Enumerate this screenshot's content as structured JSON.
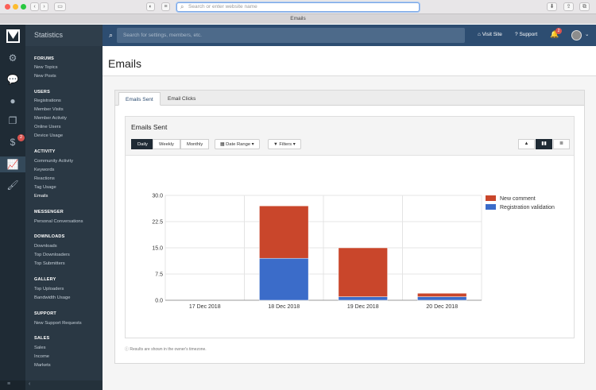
{
  "browser": {
    "url_placeholder": "Search or enter website name",
    "tab_title": "Emails"
  },
  "sidebar": {
    "title": "Statistics",
    "badge_count": "2",
    "sections": [
      {
        "title": "FORUMS",
        "links": [
          "New Topics",
          "New Posts"
        ]
      },
      {
        "title": "USERS",
        "links": [
          "Registrations",
          "Member Visits",
          "Member Activity",
          "Online Users",
          "Device Usage"
        ]
      },
      {
        "title": "ACTIVITY",
        "links": [
          "Community Activity",
          "Keywords",
          "Reactions",
          "Tag Usage",
          "Emails"
        ]
      },
      {
        "title": "MESSENGER",
        "links": [
          "Personal Conversations"
        ]
      },
      {
        "title": "DOWNLOADS",
        "links": [
          "Downloads",
          "Top Downloaders",
          "Top Submitters"
        ]
      },
      {
        "title": "GALLERY",
        "links": [
          "Top Uploaders",
          "Bandwidth Usage"
        ]
      },
      {
        "title": "SUPPORT",
        "links": [
          "New Support Requests"
        ]
      },
      {
        "title": "SALES",
        "links": [
          "Sales",
          "Income",
          "Markets"
        ]
      }
    ]
  },
  "topbar": {
    "search_placeholder": "Search for settings, members, etc.",
    "visit_site": "Visit Site",
    "support": "Support",
    "notification_count": "2"
  },
  "page": {
    "title": "Emails",
    "tabs": [
      "Emails Sent",
      "Email Clicks"
    ],
    "block_title": "Emails Sent",
    "periods": [
      "Daily",
      "Weekly",
      "Monthly"
    ],
    "date_range": "Date Range",
    "filters": "Filters",
    "timezone_note": "Results are shown in the owner's timezone."
  },
  "chart_data": {
    "type": "bar",
    "stacked": true,
    "categories": [
      "17 Dec 2018",
      "18 Dec 2018",
      "19 Dec 2018",
      "20 Dec 2018"
    ],
    "series": [
      {
        "name": "New comment",
        "color": "#c9462b",
        "values": [
          0,
          15,
          14,
          1
        ]
      },
      {
        "name": "Registration validation",
        "color": "#3b6cc9",
        "values": [
          0,
          12,
          1,
          1
        ]
      }
    ],
    "yticks": [
      "0.0",
      "7.5",
      "15.0",
      "22.5",
      "30.0"
    ],
    "ylim": [
      0,
      30
    ],
    "grid": true,
    "legend": "right"
  }
}
